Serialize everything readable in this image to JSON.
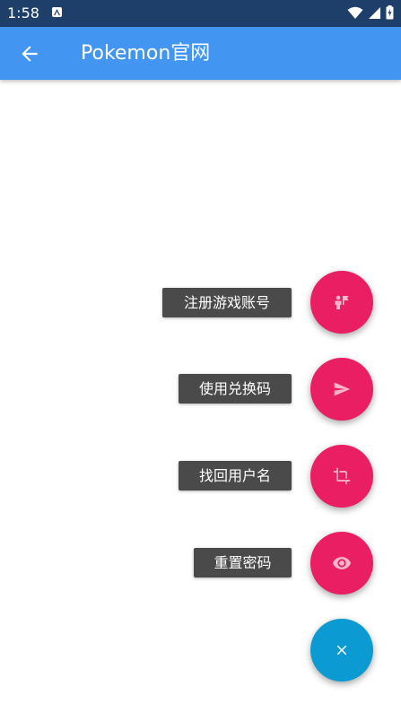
{
  "status_bar": {
    "time": "1:58",
    "icons": [
      "notification-a-icon",
      "wifi-icon",
      "signal-icon",
      "battery-charging-icon"
    ]
  },
  "app_bar": {
    "title": "Pokemon官网",
    "back_icon": "arrow-left-icon"
  },
  "speed_dial": {
    "actions": [
      {
        "label": "注册游戏账号",
        "icon": "person-flag-icon"
      },
      {
        "label": "使用兑换码",
        "icon": "send-icon"
      },
      {
        "label": "找回用户名",
        "icon": "crop-icon"
      },
      {
        "label": "重置密码",
        "icon": "eye-icon"
      }
    ],
    "main_icon": "close-icon"
  },
  "colors": {
    "status_bar": "#1e3f6a",
    "app_bar": "#4295f0",
    "fab_action": "#e91e63",
    "fab_main": "#0b9ad1",
    "label_bg": "#4a4a4a"
  }
}
